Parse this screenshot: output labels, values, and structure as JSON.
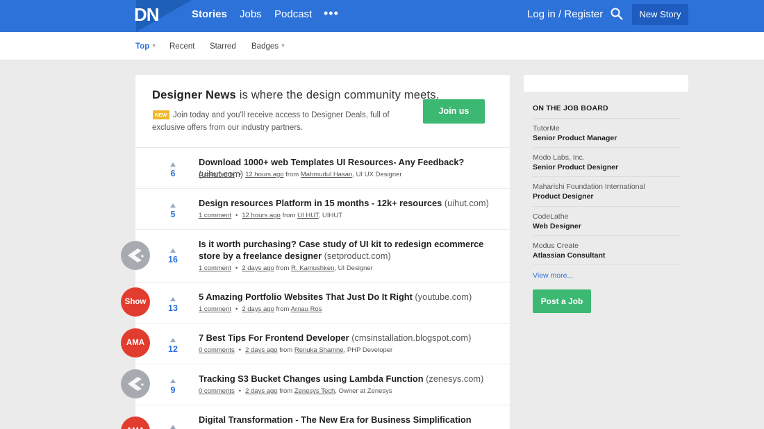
{
  "header": {
    "logo": "DN",
    "nav": [
      "Stories",
      "Jobs",
      "Podcast"
    ],
    "more": "•••",
    "login": "Log in / Register",
    "new_story": "New Story",
    "brand_color": "#2d72d9"
  },
  "subnav": {
    "items": [
      "Top",
      "Recent",
      "Starred",
      "Badges"
    ]
  },
  "welcome": {
    "brand": "Designer News",
    "tagline": "is where the design community meets.",
    "badge": "NEW",
    "text": "Join today and you'll receive access to Designer Deals, full of exclusive offers from our industry partners.",
    "join": "Join us"
  },
  "stories": [
    {
      "votes": "6",
      "title": "Download 1000+ web Templates UI Resources- Any Feedback?",
      "domain": "(uihut.com)",
      "comments": "4 comments",
      "time": "12 hours ago",
      "author": "Mahmudul Hasan",
      "role": ", UI UX Designer",
      "badge": ""
    },
    {
      "votes": "5",
      "title": "Design resources Platform in 15 months - 12k+ resources",
      "domain": "(uihut.com)",
      "comments": "1 comment",
      "time": "12 hours ago",
      "author": "UI HUT",
      "role": ", UIHUT",
      "badge": ""
    },
    {
      "votes": "16",
      "title": "Is it worth purchasing? Case study of UI kit to redesign ecommerce store by a freelance designer",
      "domain": "(setproduct.com)",
      "comments": "1 comment",
      "time": "2 days ago",
      "author": "R. Kamushken",
      "role": ", UI Designer",
      "badge": "grey-icon"
    },
    {
      "votes": "13",
      "title": "5 Amazing Portfolio Websites That Just Do It Right",
      "domain": "(youtube.com)",
      "comments": "1 comment",
      "time": "2 days ago",
      "author": "Arnau Ros",
      "role": "",
      "badge": "Show"
    },
    {
      "votes": "12",
      "title": "7 Best Tips For Frontend Developer",
      "domain": "(cmsinstallation.blogspot.com)",
      "comments": "0 comments",
      "time": "2 days ago",
      "author": "Renuka Shamne",
      "role": ", PHP Developer",
      "badge": "AMA"
    },
    {
      "votes": "9",
      "title": "Tracking S3 Bucket Changes using Lambda Function",
      "domain": "(zenesys.com)",
      "comments": "0 comments",
      "time": "2 days ago",
      "author": "Zenesys Tech",
      "role": ", Owner at Zenesys",
      "badge": "grey-icon"
    },
    {
      "votes": "",
      "title": "Digital Transformation - The New Era for Business Simplification",
      "domain": "",
      "comments": "",
      "time": "",
      "author": "",
      "role": "",
      "badge": "AMA"
    }
  ],
  "meta_sep": {
    "from": "from",
    "dot": "•"
  },
  "sidebar": {
    "heading": "ON THE JOB BOARD",
    "jobs": [
      {
        "company": "TutorMe",
        "role": "Senior Product Manager"
      },
      {
        "company": "Modo Labs, Inc.",
        "role": "Senior Product Designer"
      },
      {
        "company": "Maharishi Foundation International",
        "role": "Product Designer"
      },
      {
        "company": "CodeLathe",
        "role": "Web Designer"
      },
      {
        "company": "Modus Create",
        "role": "Atlassian Consultant"
      }
    ],
    "view_more": "View more...",
    "post_job": "Post a Job"
  }
}
